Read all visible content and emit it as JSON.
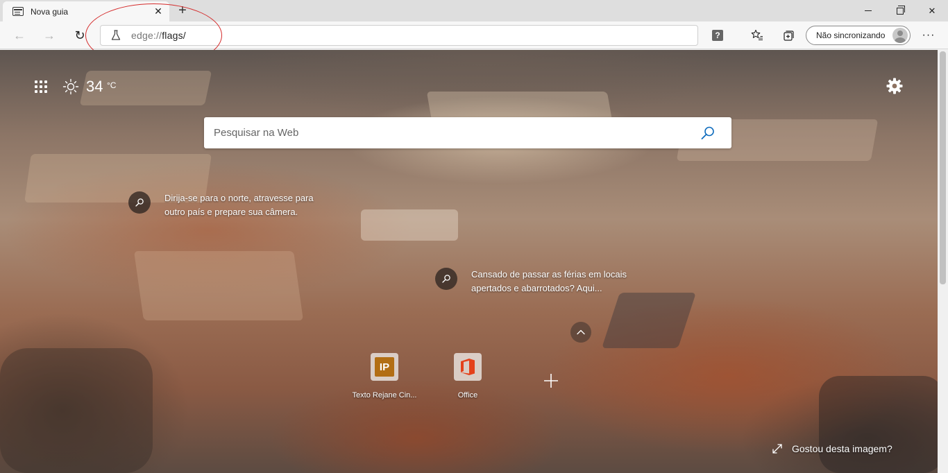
{
  "tab": {
    "title": "Nova guia",
    "close_glyph": "✕",
    "favicon": "page-icon"
  },
  "new_tab_glyph": "+",
  "window_controls": {
    "close_glyph": "✕"
  },
  "toolbar": {
    "back_glyph": "←",
    "forward_glyph": "→",
    "refresh_glyph": "↻",
    "address_scheme": "edge://",
    "address_path": "flags/",
    "help_glyph": "?",
    "profile_label": "Não sincronizando",
    "more_glyph": "···"
  },
  "annotation": {
    "color": "#d42a2a"
  },
  "page": {
    "temperature": "34",
    "temperature_unit": "°C",
    "search_placeholder": "Pesquisar na Web",
    "stories": [
      {
        "text": "Dirija-se para o norte, atravesse para outro país e prepare sua câmera."
      },
      {
        "text": "Cansado de passar as férias em locais apertados e abarrotados? Aqui..."
      }
    ],
    "tiles": [
      {
        "label": "Texto Rejane Cin...",
        "logo_text": "IP",
        "logo_color": "#b26e14"
      },
      {
        "label": "Office",
        "logo_color": "#e4411b"
      }
    ],
    "like_image_label": "Gostou desta imagem?"
  },
  "colors": {
    "accent": "#0f6cbd",
    "office": "#e4411b"
  }
}
